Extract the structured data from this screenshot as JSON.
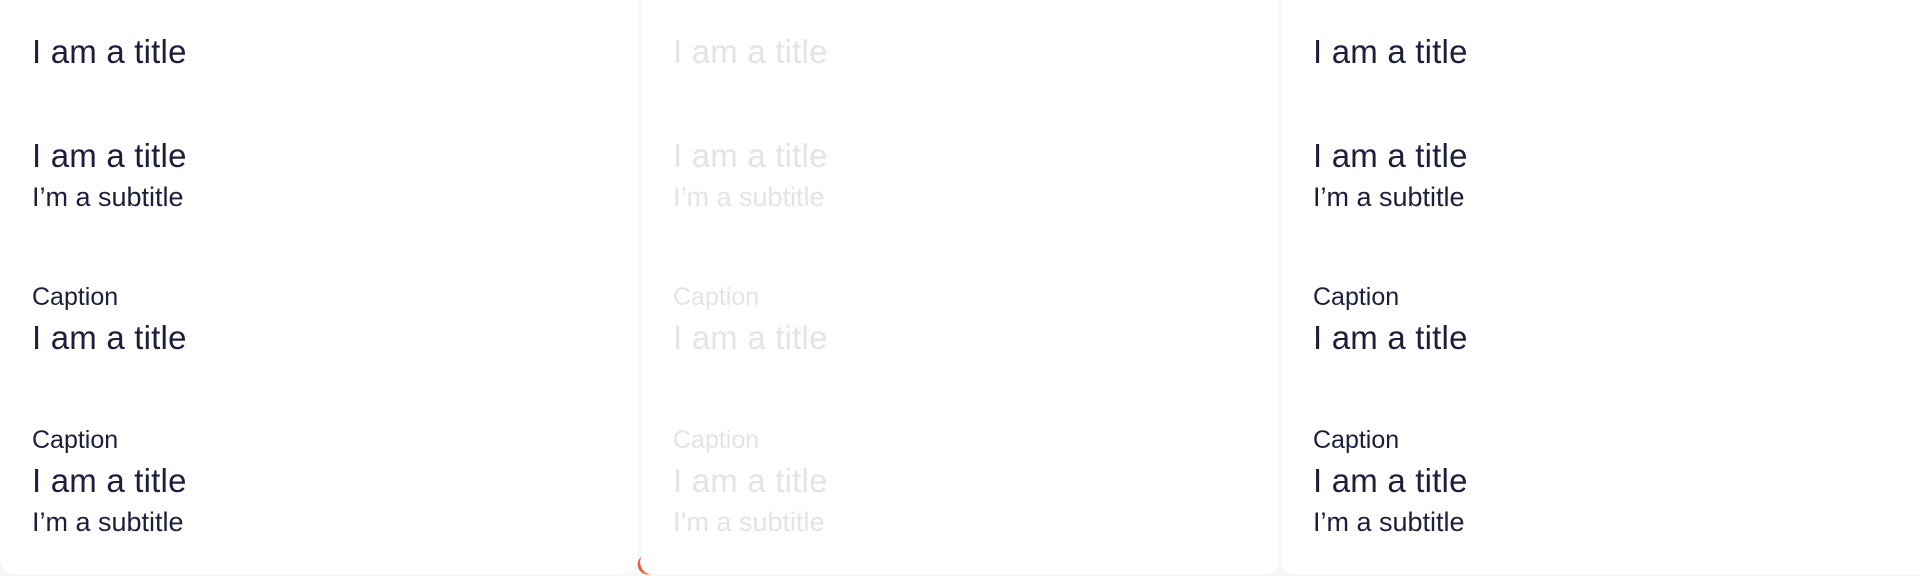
{
  "cards": [
    {
      "state": "default",
      "title_only": {
        "title": "I am a title"
      },
      "title_subtitle": {
        "title": "I am a title",
        "subtitle": "I’m a subtitle"
      },
      "caption_title": {
        "caption": "Caption",
        "title": "I am a title"
      },
      "caption_title_subtitle": {
        "caption": "Caption",
        "title": "I am a title",
        "subtitle": "I’m a subtitle"
      }
    },
    {
      "state": "disabled",
      "title_only": {
        "title": "I am a title"
      },
      "title_subtitle": {
        "title": "I am a title",
        "subtitle": "I’m a subtitle"
      },
      "caption_title": {
        "caption": "Caption",
        "title": "I am a title"
      },
      "caption_title_subtitle": {
        "caption": "Caption",
        "title": "I am a title",
        "subtitle": "I’m a subtitle"
      }
    },
    {
      "state": "default",
      "title_only": {
        "title": "I am a title"
      },
      "title_subtitle": {
        "title": "I am a title",
        "subtitle": "I’m a subtitle"
      },
      "caption_title": {
        "caption": "Caption",
        "title": "I am a title"
      },
      "caption_title_subtitle": {
        "caption": "Caption",
        "title": "I am a title",
        "subtitle": "I’m a subtitle"
      }
    }
  ],
  "colors": {
    "text_primary": "#1b1f3b",
    "text_disabled": "#e3e4e8",
    "card_background": "#ffffff",
    "page_background": "#f7f7f9"
  }
}
